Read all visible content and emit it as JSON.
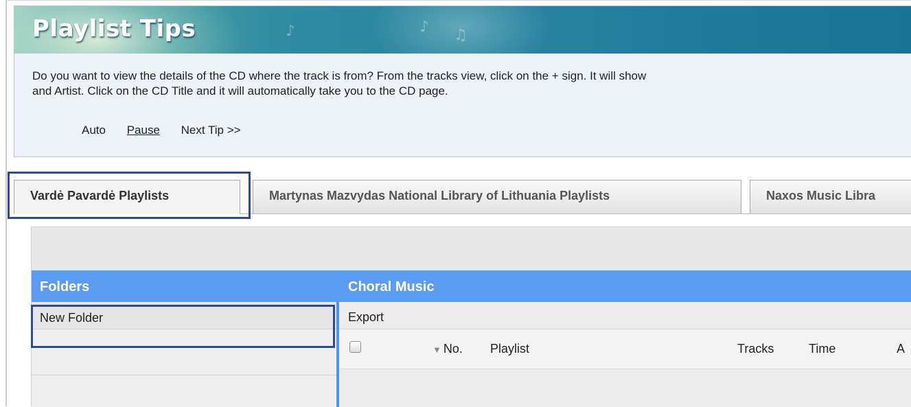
{
  "tips": {
    "title": "Playlist Tips",
    "text_line1": "Do you want to view the details of the CD where the track is from? From the tracks view, click on the + sign. It will show",
    "text_line2": "and Artist. Click on the CD Title and it will automatically take you to the CD page.",
    "controls": {
      "auto": "Auto",
      "pause": "Pause",
      "next": "Next Tip >>"
    }
  },
  "tabs": [
    {
      "label": "Vardė Pavardė Playlists",
      "active": true
    },
    {
      "label": "Martynas Mazvydas National Library of Lithuania Playlists",
      "active": false
    },
    {
      "label": "Naxos Music Libra",
      "active": false
    }
  ],
  "folders": {
    "header": "Folders",
    "items": [
      {
        "label": "New Folder"
      }
    ]
  },
  "playlist_panel": {
    "title": "Choral Music",
    "export_label": "Export",
    "columns": {
      "no": "No.",
      "playlist": "Playlist",
      "tracks": "Tracks",
      "time": "Time",
      "extra": "A"
    }
  },
  "colors": {
    "accent_blue": "#5b9cf0",
    "highlight_border": "#2f4a8f",
    "banner_teal": "#2a84a0"
  }
}
